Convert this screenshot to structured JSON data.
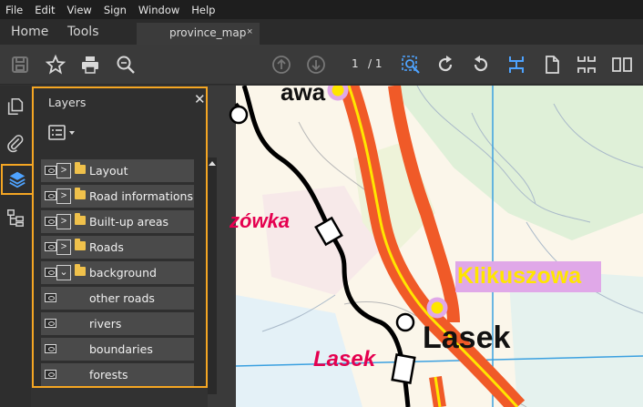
{
  "menu": [
    "File",
    "Edit",
    "View",
    "Sign",
    "Window",
    "Help"
  ],
  "tabs": {
    "home": "Home",
    "tools": "Tools",
    "document": "province_map",
    "close": "×"
  },
  "toolbar": {
    "page_current": "1",
    "page_total": "/ 1"
  },
  "layers_panel": {
    "title": "Layers",
    "close": "✕",
    "layers": [
      {
        "label": "Layout",
        "type": "folder",
        "expanded": false
      },
      {
        "label": "Road informations",
        "type": "folder",
        "expanded": false
      },
      {
        "label": "Built-up areas",
        "type": "folder",
        "expanded": false
      },
      {
        "label": "Roads",
        "type": "folder",
        "expanded": false
      },
      {
        "label": "background",
        "type": "folder",
        "expanded": true
      },
      {
        "label": "other roads",
        "type": "layer"
      },
      {
        "label": "rivers",
        "type": "layer"
      },
      {
        "label": "boundaries",
        "type": "layer"
      },
      {
        "label": "forests",
        "type": "layer"
      }
    ]
  },
  "map": {
    "labels": {
      "top_partial": "awa",
      "left_partial": "zówka",
      "klikuszowa": "Klikuszowa",
      "lasek_black": "Lasek",
      "lasek_red": "Lasek"
    },
    "colors": {
      "main_road": "#f05a28",
      "road_center": "#ffe600",
      "place_red": "#e5004f",
      "highlight": "#e0a8e8"
    }
  }
}
